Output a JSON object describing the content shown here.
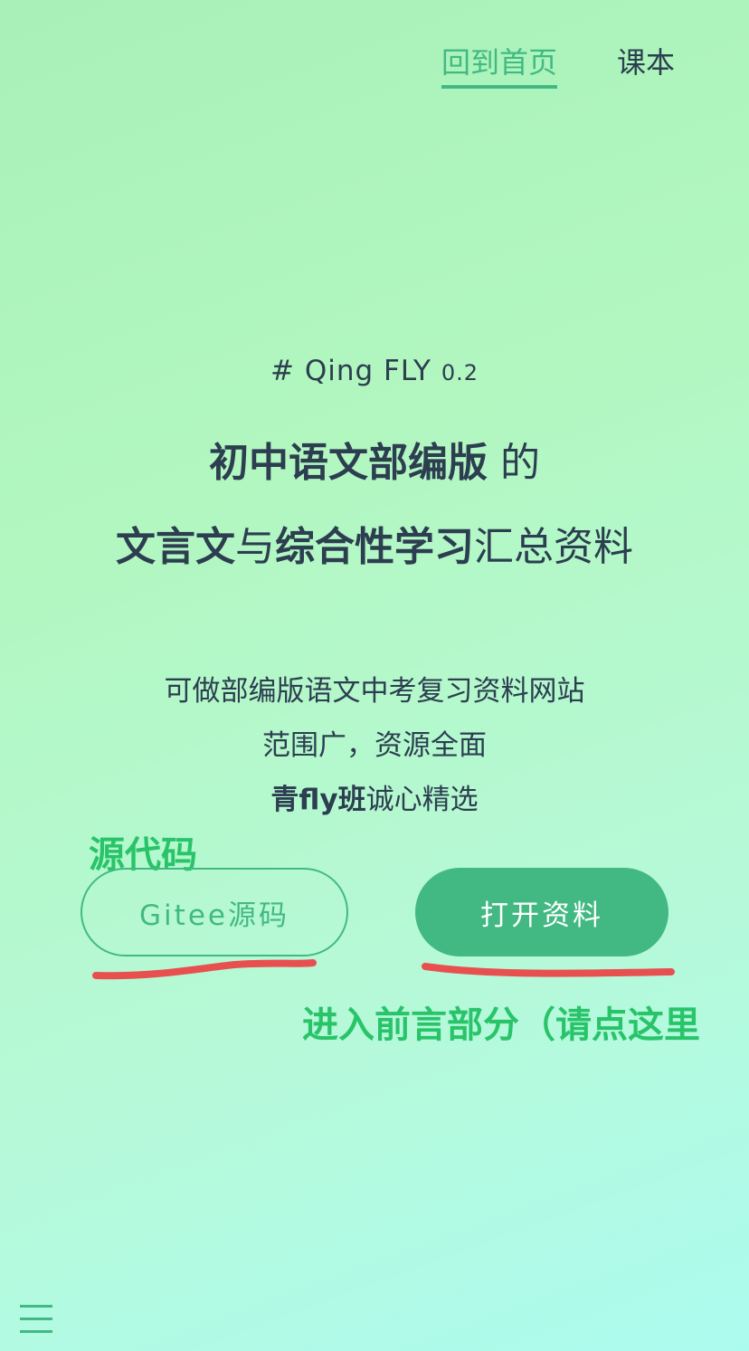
{
  "nav": {
    "home": "回到首页",
    "textbook": "课本"
  },
  "hero": {
    "tag_prefix": "# Qing FLY",
    "tag_version": "0.2",
    "title_line1_bold": "初中语文部编版",
    "title_line1_rest": " 的",
    "title_line2_part1": "文言文",
    "title_line2_part2": "与",
    "title_line2_part3": "综合性学习",
    "title_line2_part4": "汇总资料",
    "desc1": "可做部编版语文中考复习资料网站",
    "desc2": "范围广，资源全面",
    "desc3_bold": "青fly班",
    "desc3_rest": "诚心精选"
  },
  "buttons": {
    "gitee": "Gitee源码",
    "open": "打开资料"
  },
  "annotations": {
    "source_code": "源代码",
    "enter_preface": "进入前言部分（请点这里"
  },
  "icons": {
    "menu": "hamburger-menu-icon"
  },
  "colors": {
    "accent": "#42b983",
    "annotation_green": "#29c46a",
    "annotation_red": "#e8504f"
  }
}
